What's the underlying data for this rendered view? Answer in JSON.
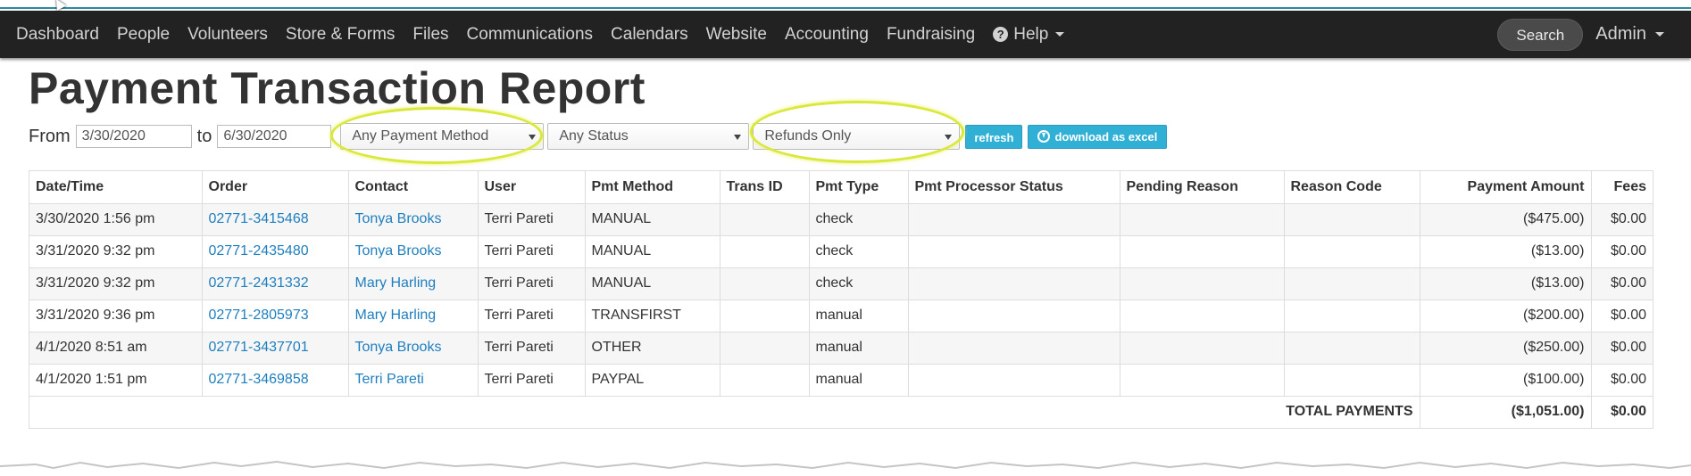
{
  "nav": {
    "items": [
      "Dashboard",
      "People",
      "Volunteers",
      "Store & Forms",
      "Files",
      "Communications",
      "Calendars",
      "Website",
      "Accounting",
      "Fundraising"
    ],
    "help": "Help",
    "search": "Search",
    "admin": "Admin"
  },
  "page": {
    "title": "Payment Transaction Report"
  },
  "filters": {
    "from_label": "From",
    "from_value": "3/30/2020",
    "to_label": "to",
    "to_value": "6/30/2020",
    "payment_method": "Any Payment Method",
    "status": "Any Status",
    "refund_filter": "Refunds Only",
    "refresh": "refresh",
    "download": "download as excel"
  },
  "table": {
    "headers": [
      "Date/Time",
      "Order",
      "Contact",
      "User",
      "Pmt Method",
      "Trans ID",
      "Pmt Type",
      "Pmt Processor Status",
      "Pending Reason",
      "Reason Code",
      "Payment Amount",
      "Fees"
    ],
    "rows": [
      {
        "datetime": "3/30/2020 1:56 pm",
        "order": "02771-3415468",
        "contact": "Tonya Brooks",
        "user": "Terri Pareti",
        "method": "MANUAL",
        "trans_id": "",
        "type": "check",
        "status": "",
        "pending": "",
        "reason": "",
        "amount": "($475.00)",
        "fees": "$0.00"
      },
      {
        "datetime": "3/31/2020 9:32 pm",
        "order": "02771-2435480",
        "contact": "Tonya Brooks",
        "user": "Terri Pareti",
        "method": "MANUAL",
        "trans_id": "",
        "type": "check",
        "status": "",
        "pending": "",
        "reason": "",
        "amount": "($13.00)",
        "fees": "$0.00"
      },
      {
        "datetime": "3/31/2020 9:32 pm",
        "order": "02771-2431332",
        "contact": "Mary Harling",
        "user": "Terri Pareti",
        "method": "MANUAL",
        "trans_id": "",
        "type": "check",
        "status": "",
        "pending": "",
        "reason": "",
        "amount": "($13.00)",
        "fees": "$0.00"
      },
      {
        "datetime": "3/31/2020 9:36 pm",
        "order": "02771-2805973",
        "contact": "Mary Harling",
        "user": "Terri Pareti",
        "method": "TRANSFIRST",
        "trans_id": "",
        "type": "manual",
        "status": "",
        "pending": "",
        "reason": "",
        "amount": "($200.00)",
        "fees": "$0.00"
      },
      {
        "datetime": "4/1/2020 8:51 am",
        "order": "02771-3437701",
        "contact": "Tonya Brooks",
        "user": "Terri Pareti",
        "method": "OTHER",
        "trans_id": "",
        "type": "manual",
        "status": "",
        "pending": "",
        "reason": "",
        "amount": "($250.00)",
        "fees": "$0.00"
      },
      {
        "datetime": "4/1/2020 1:51 pm",
        "order": "02771-3469858",
        "contact": "Terri Pareti",
        "user": "Terri Pareti",
        "method": "PAYPAL",
        "trans_id": "",
        "type": "manual",
        "status": "",
        "pending": "",
        "reason": "",
        "amount": "($100.00)",
        "fees": "$0.00"
      }
    ],
    "total_label": "TOTAL PAYMENTS",
    "total_amount": "($1,051.00)",
    "total_fees": "$0.00"
  },
  "colors": {
    "navbar": "#222222",
    "link": "#1e7fbf",
    "button": "#31b0d5",
    "highlight": "#d9e83a",
    "accent_strip": "#2a8aa0"
  }
}
